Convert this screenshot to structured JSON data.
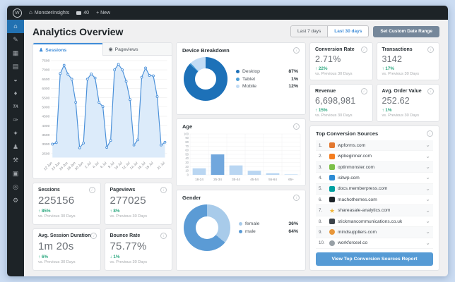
{
  "admin_bar": {
    "site_name": "MonsterInsights",
    "comments_count": "40",
    "new_label": "+ New"
  },
  "sidebar": {
    "items": [
      {
        "name": "dashboard",
        "glyph": "⌂",
        "active": true
      },
      {
        "name": "posts",
        "glyph": "✎",
        "active": false
      },
      {
        "name": "media",
        "glyph": "▦",
        "active": false
      },
      {
        "name": "pages",
        "glyph": "▤",
        "active": false
      },
      {
        "name": "comments",
        "glyph": "◒",
        "active": false
      },
      {
        "name": "custom-post",
        "glyph": "♦",
        "active": false
      },
      {
        "name": "tablepress",
        "glyph": "TA",
        "active": false
      },
      {
        "name": "appearance",
        "glyph": "✑",
        "active": false
      },
      {
        "name": "plugins",
        "glyph": "✦",
        "active": false
      },
      {
        "name": "users",
        "glyph": "♟",
        "active": false
      },
      {
        "name": "tools",
        "glyph": "⚒",
        "active": false
      },
      {
        "name": "insights",
        "glyph": "▣",
        "active": false
      },
      {
        "name": "seo",
        "glyph": "◎",
        "active": false
      },
      {
        "name": "settings",
        "glyph": "⚙",
        "active": false
      }
    ]
  },
  "header": {
    "title": "Analytics Overview",
    "range_buttons": [
      {
        "label": "Last 7 days",
        "active": false
      },
      {
        "label": "Last 30 days",
        "active": true
      }
    ],
    "custom_range_label": "Set Custom Date Range"
  },
  "tabs": [
    {
      "label": "Sessions",
      "icon": "person-icon",
      "active": true
    },
    {
      "label": "Pageviews",
      "icon": "eye-icon",
      "active": false
    }
  ],
  "chart_data": [
    {
      "id": "sessions",
      "type": "area",
      "title": "Sessions",
      "values": [
        3000,
        3080,
        6800,
        7250,
        6760,
        6500,
        5250,
        2800,
        3060,
        6500,
        6780,
        6560,
        5250,
        5020,
        2820,
        3200,
        7000,
        7300,
        7000,
        6380,
        5400,
        2950,
        3230,
        6600,
        7100,
        6700,
        6680,
        5560,
        2950,
        3100
      ],
      "x_tick_labels": [
        "22 Jun",
        "24 Jun",
        "26 Jun",
        "28 Jun",
        "30 Jun",
        "2 Jul",
        "4 Jul",
        "6 Jul",
        "8 Jul",
        "10 Jul",
        "12 Jul",
        "14 Jul",
        "16 Jul",
        "18 Jul",
        "21 Jul"
      ],
      "x_tick_indexes": [
        0,
        2,
        4,
        6,
        8,
        10,
        12,
        14,
        16,
        18,
        20,
        22,
        24,
        26,
        29
      ],
      "ylim": [
        2500,
        7500
      ],
      "yticks": [
        2500,
        3000,
        3500,
        4000,
        4500,
        5000,
        5500,
        6000,
        6500,
        7000,
        7500
      ],
      "line_color": "#4a90d9",
      "fill_color": "#dcebfa",
      "grid": true
    },
    {
      "id": "device",
      "type": "pie",
      "title": "Device Breakdown",
      "labels": [
        "Desktop",
        "Tablet",
        "Mobile"
      ],
      "values": [
        87,
        1,
        12
      ],
      "colors": [
        "#1d71b8",
        "#4a9fd8",
        "#c2dcf5"
      ],
      "legend_position": "right"
    },
    {
      "id": "age",
      "type": "bar",
      "title": "Age",
      "categories": [
        "18-24",
        "25-34",
        "35-44",
        "45-54",
        "55-64",
        "65+"
      ],
      "values": [
        16,
        50,
        23,
        10,
        4,
        1
      ],
      "ylim": [
        0,
        100
      ],
      "yticks": [
        0,
        10,
        20,
        30,
        40,
        50,
        60,
        70,
        80,
        90,
        100
      ],
      "bar_color": "#b9d6f2",
      "highlight_index": 1,
      "highlight_color": "#71a7dd",
      "grid": true
    },
    {
      "id": "gender",
      "type": "pie",
      "title": "Gender",
      "labels": [
        "female",
        "male"
      ],
      "values": [
        36,
        64
      ],
      "colors": [
        "#a8cbea",
        "#5b9bd5"
      ],
      "legend_position": "right"
    }
  ],
  "stats": {
    "compare_label": "vs. Previous 30 Days",
    "left": [
      {
        "label": "Sessions",
        "value": "225156",
        "change": "85%",
        "direction": "up"
      },
      {
        "label": "Pageviews",
        "value": "277025",
        "change": "8%",
        "direction": "up"
      },
      {
        "label": "Avg. Session Duration",
        "value": "1m 20s",
        "change": "6%",
        "direction": "up"
      },
      {
        "label": "Bounce Rate",
        "value": "75.77%",
        "change": "1%",
        "direction": "down"
      }
    ],
    "right": [
      {
        "label": "Conversion Rate",
        "value": "2.71%",
        "change": "22%",
        "direction": "up"
      },
      {
        "label": "Transactions",
        "value": "3142",
        "change": "17%",
        "direction": "up"
      },
      {
        "label": "Revenue",
        "value": "6,698,981",
        "change": "15%",
        "direction": "up"
      },
      {
        "label": "Avg. Order Value",
        "value": "252.62",
        "change": "1%",
        "direction": "up"
      }
    ]
  },
  "sources": {
    "title": "Top Conversion Sources",
    "items": [
      {
        "rank": "1.",
        "domain": "wpforms.com",
        "icon_type": "square",
        "icon_color": "#e27730"
      },
      {
        "rank": "2.",
        "domain": "wpbeginner.com",
        "icon_type": "square",
        "icon_color": "#f47d20"
      },
      {
        "rank": "3.",
        "domain": "optinmonster.com",
        "icon_type": "square",
        "icon_color": "#7cc048"
      },
      {
        "rank": "4.",
        "domain": "isitwp.com",
        "icon_type": "square",
        "icon_color": "#2d8bd4"
      },
      {
        "rank": "5.",
        "domain": "docs.memberpress.com",
        "icon_type": "square",
        "icon_color": "#00a0a0"
      },
      {
        "rank": "6.",
        "domain": "machothemes.com",
        "icon_type": "square",
        "icon_color": "#1d2327"
      },
      {
        "rank": "7.",
        "domain": "shareasale-analytics.com",
        "icon_type": "star",
        "icon_color": "#f0b63a"
      },
      {
        "rank": "8.",
        "domain": "stickmancommunications.co.uk",
        "icon_type": "square",
        "icon_color": "#3c434a"
      },
      {
        "rank": "9.",
        "domain": "mindsuppliers.com",
        "icon_type": "circle",
        "icon_color": "#e8973a"
      },
      {
        "rank": "10.",
        "domain": "workforcexl.co",
        "icon_type": "circle",
        "icon_color": "#98a0a6"
      }
    ],
    "button_label": "View Top Conversion Sources Report"
  },
  "colors": {
    "accent_blue": "#3f8cd8",
    "positive_green": "#2ca87f",
    "admin_dark": "#1d2327",
    "active_item_blue": "#2271b1"
  }
}
